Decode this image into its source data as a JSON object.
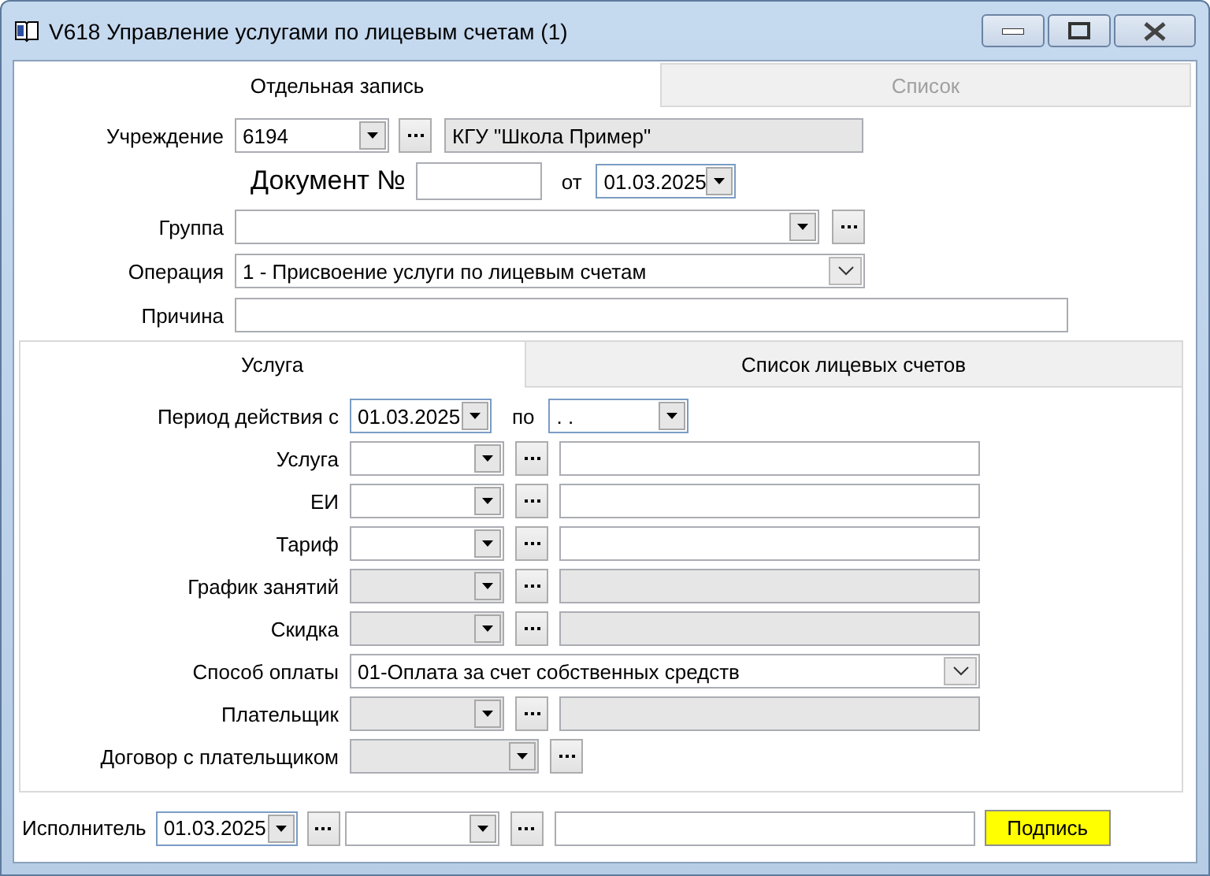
{
  "window": {
    "title": "V618 Управление услугами по лицевым счетам (1)"
  },
  "tabs": [
    {
      "label": "Отдельная запись",
      "selected": true,
      "disabled": false
    },
    {
      "label": "Список",
      "selected": false,
      "disabled": true
    }
  ],
  "institution": {
    "label": "Учреждение",
    "code": "6194",
    "name": "КГУ \"Школа Пример\""
  },
  "document": {
    "label": "Документ №",
    "date_label": "от",
    "date": "01.03.2025"
  },
  "group": {
    "label": "Группа"
  },
  "operation": {
    "label": "Операция",
    "value": "1 - Присвоение услуги по лицевым счетам"
  },
  "reason": {
    "label": "Причина"
  },
  "inner_tabs": [
    {
      "label": "Услуга",
      "selected": true
    },
    {
      "label": "Список лицевых счетов",
      "selected": false
    }
  ],
  "period": {
    "label": "Период действия с",
    "from": "01.03.2025",
    "to_label": "по",
    "to": ".  ."
  },
  "fields": [
    {
      "kind": "lookup",
      "label": "Услуга",
      "disabled": false
    },
    {
      "kind": "lookup",
      "label": "ЕИ",
      "disabled": false
    },
    {
      "kind": "lookup",
      "label": "Тариф",
      "disabled": false
    },
    {
      "kind": "lookup",
      "label": "График занятий",
      "disabled": true
    },
    {
      "kind": "lookup",
      "label": "Скидка",
      "disabled": true
    },
    {
      "kind": "select",
      "label": "Способ оплаты",
      "value": "01-Оплата за счет собственных средств",
      "disabled": false
    },
    {
      "kind": "lookup",
      "label": "Плательщик",
      "disabled": true
    },
    {
      "kind": "short",
      "label": "Договор с плательщиком",
      "disabled": true
    }
  ],
  "footer": {
    "label": "Исполнитель",
    "date": "01.03.2025",
    "sign_button": "Подпись"
  }
}
